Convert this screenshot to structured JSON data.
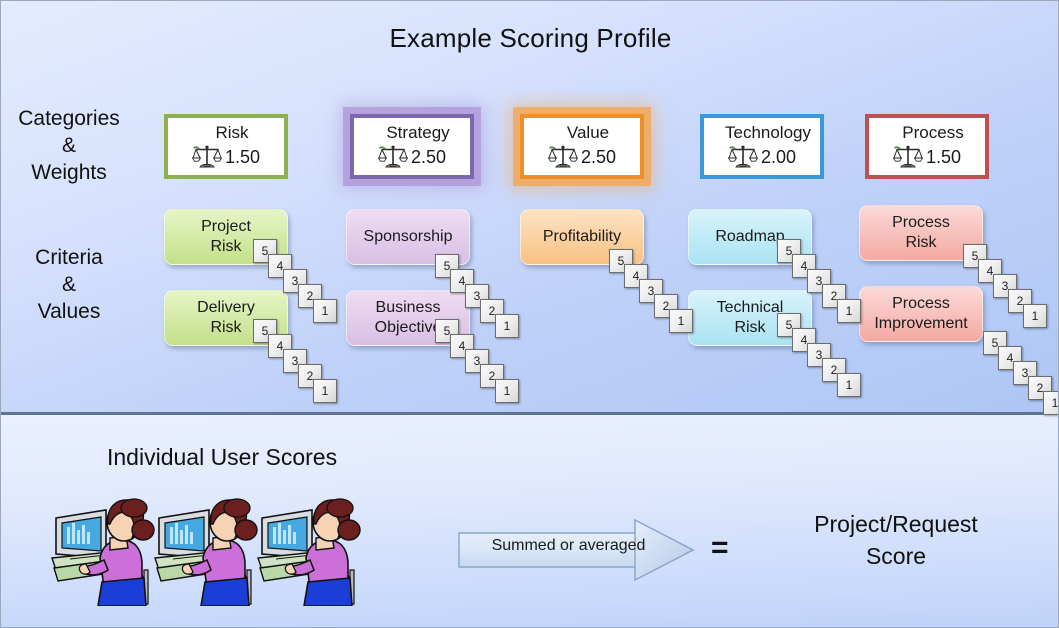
{
  "title": "Example Scoring Profile",
  "row_labels": {
    "categories": "Categories\n&\nWeights",
    "categories_l1": "Categories",
    "categories_l2": "&",
    "categories_l3": "Weights",
    "criteria_l1": "Criteria",
    "criteria_l2": "&",
    "criteria_l3": "Values"
  },
  "scale_icon_name": "balance-scale-icon",
  "categories": [
    {
      "name": "Risk",
      "weight": "1.50",
      "border_color": "#8db14e",
      "glow": "none"
    },
    {
      "name": "Strategy",
      "weight": "2.50",
      "border_color": "#7c66b0",
      "glow": "purple"
    },
    {
      "name": "Value",
      "weight": "2.50",
      "border_color": "#ef8f2a",
      "glow": "orange"
    },
    {
      "name": "Technology",
      "weight": "2.00",
      "border_color": "#3a9ad9",
      "glow": "none"
    },
    {
      "name": "Process",
      "weight": "1.50",
      "border_color": "#c0504d",
      "glow": "none"
    }
  ],
  "criteria": [
    {
      "line1": "Project",
      "line2": "Risk",
      "fill_top": "#e6f5c6",
      "fill_bottom": "#c3e08a"
    },
    {
      "line1": "Delivery",
      "line2": "Risk",
      "fill_top": "#e6f5c6",
      "fill_bottom": "#c3e08a"
    },
    {
      "line1": "Sponsorship",
      "line2": "",
      "fill_top": "#efdcf2",
      "fill_bottom": "#d8bfe4"
    },
    {
      "line1": "Business",
      "line2": "Objective",
      "fill_top": "#efdcf2",
      "fill_bottom": "#d8bfe4"
    },
    {
      "line1": "Profitability",
      "line2": "",
      "fill_top": "#fde3c3",
      "fill_bottom": "#f8c183"
    },
    {
      "line1": "Roadmap",
      "line2": "",
      "fill_top": "#d9f3fb",
      "fill_bottom": "#aae3f3"
    },
    {
      "line1": "Technical",
      "line2": "Risk",
      "fill_top": "#d9f3fb",
      "fill_bottom": "#aae3f3"
    },
    {
      "line1": "Process",
      "line2": "Risk",
      "fill_top": "#fbdad7",
      "fill_bottom": "#f4a9a2"
    },
    {
      "line1": "Process",
      "line2": "Improvement",
      "fill_top": "#fbdad7",
      "fill_bottom": "#f4a9a2"
    }
  ],
  "score_card_values": [
    "5",
    "4",
    "3",
    "2",
    "1"
  ],
  "lower": {
    "title": "Individual User Scores",
    "person_icon_name": "person-at-computer-icon",
    "person_count": 3,
    "arrow_label": "Summed or averaged",
    "equals": "=",
    "result_line1": "Project/Request",
    "result_line2": "Score"
  },
  "colors": {
    "background_top": "#dfe8fe",
    "background_bottom": "#aec6f6",
    "divider": "#5f7396",
    "arrow_fill_light": "#e8f0fc",
    "arrow_fill_dark": "#bed4ee",
    "arrow_border": "#8aa6c8"
  }
}
